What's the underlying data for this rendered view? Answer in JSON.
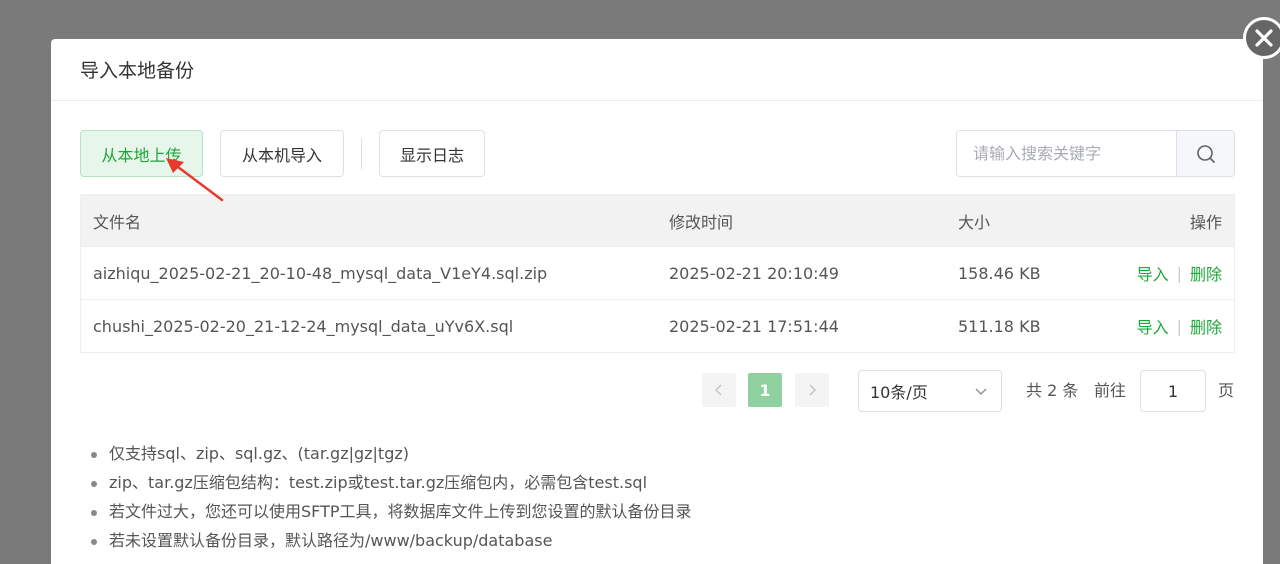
{
  "dialog": {
    "title": "导入本地备份"
  },
  "toolbar": {
    "upload_local_label": "从本地上传",
    "import_machine_label": "从本机导入",
    "show_log_label": "显示日志"
  },
  "search": {
    "placeholder": "请输入搜索关键字"
  },
  "table": {
    "headers": {
      "name": "文件名",
      "mtime": "修改时间",
      "size": "大小",
      "actions": "操作"
    },
    "rows": [
      {
        "name": "aizhiqu_2025-02-21_20-10-48_mysql_data_V1eY4.sql.zip",
        "mtime": "2025-02-21 20:10:49",
        "size": "158.46 KB",
        "import": "导入",
        "delete": "删除"
      },
      {
        "name": "chushi_2025-02-20_21-12-24_mysql_data_uYv6X.sql",
        "mtime": "2025-02-21 17:51:44",
        "size": "511.18 KB",
        "import": "导入",
        "delete": "删除"
      }
    ]
  },
  "pagination": {
    "current_page": "1",
    "page_size": "10条/页",
    "total_text": "共 2 条",
    "goto_label": "前往",
    "goto_value": "1",
    "page_suffix": "页"
  },
  "tips": [
    "仅支持sql、zip、sql.gz、(tar.gz|gz|tgz)",
    "zip、tar.gz压缩包结构：test.zip或test.tar.gz压缩包内，必需包含test.sql",
    "若文件过大，您还可以使用SFTP工具，将数据库文件上传到您设置的默认备份目录",
    "若未设置默认备份目录，默认路径为/www/backup/database"
  ],
  "colors": {
    "accent": "#20a53a",
    "overlay": "#7a7a7a",
    "annotation_arrow": "#e8392c"
  }
}
